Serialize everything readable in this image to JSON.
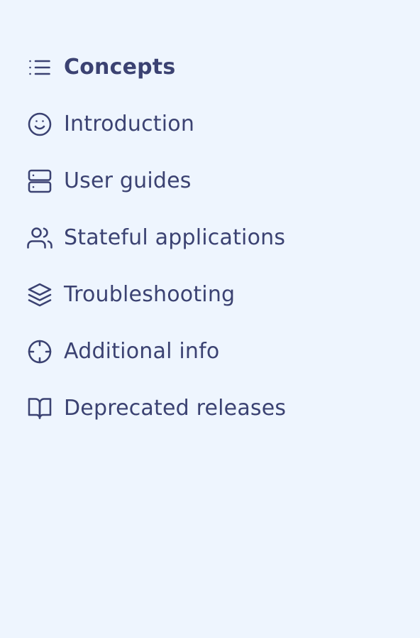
{
  "sidebar": {
    "items": [
      {
        "label": "Concepts",
        "icon": "list-icon",
        "active": true
      },
      {
        "label": "Introduction",
        "icon": "smile-icon",
        "active": false
      },
      {
        "label": "User guides",
        "icon": "server-icon",
        "active": false
      },
      {
        "label": "Stateful applications",
        "icon": "users-icon",
        "active": false
      },
      {
        "label": "Troubleshooting",
        "icon": "layers-icon",
        "active": false
      },
      {
        "label": "Additional info",
        "icon": "crosshair-icon",
        "active": false
      },
      {
        "label": "Deprecated releases",
        "icon": "book-open-icon",
        "active": false
      }
    ]
  },
  "colors": {
    "background": "#eef5fe",
    "text": "#3b4272"
  }
}
